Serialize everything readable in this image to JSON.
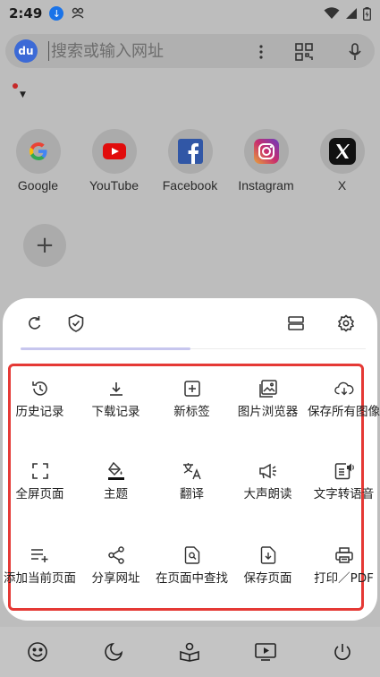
{
  "status_bar": {
    "time": "2:49",
    "icons": [
      "download-icon",
      "pilot-icon",
      "wifi-icon",
      "cellular-icon",
      "battery-icon"
    ]
  },
  "search": {
    "placeholder": "搜索或输入网址",
    "logo_text": "du",
    "icons": [
      "more-vert-icon",
      "qr-scan-icon",
      "mic-icon"
    ]
  },
  "shortcuts": [
    {
      "label": "Google",
      "icon": "google-icon"
    },
    {
      "label": "YouTube",
      "icon": "youtube-icon"
    },
    {
      "label": "Facebook",
      "icon": "facebook-icon"
    },
    {
      "label": "Instagram",
      "icon": "instagram-icon"
    },
    {
      "label": "X",
      "icon": "x-icon"
    }
  ],
  "add_shortcut": "+",
  "menu": {
    "top_icons": [
      "refresh-icon",
      "shield-icon",
      "layout-icon",
      "settings-icon"
    ],
    "items": [
      {
        "label": "历史记录",
        "icon": "history-icon"
      },
      {
        "label": "下载记录",
        "icon": "download-icon"
      },
      {
        "label": "新标签",
        "icon": "new-tab-icon"
      },
      {
        "label": "图片浏览器",
        "icon": "image-viewer-icon"
      },
      {
        "label": "保存所有图像",
        "icon": "cloud-download-icon"
      },
      {
        "label": "全屏页面",
        "icon": "fullscreen-icon"
      },
      {
        "label": "主题",
        "icon": "paint-bucket-icon"
      },
      {
        "label": "翻译",
        "icon": "translate-icon"
      },
      {
        "label": "大声朗读",
        "icon": "megaphone-icon"
      },
      {
        "label": "文字转语音",
        "icon": "text-to-speech-icon"
      },
      {
        "label": "添加当前页面",
        "icon": "playlist-add-icon"
      },
      {
        "label": "分享网址",
        "icon": "share-icon"
      },
      {
        "label": "在页面中查找",
        "icon": "find-in-page-icon"
      },
      {
        "label": "保存页面",
        "icon": "save-page-icon"
      },
      {
        "label": "打印／PDF",
        "icon": "print-icon"
      }
    ]
  },
  "bottom_nav": [
    "smile-icon",
    "moon-icon",
    "reader-icon",
    "tv-play-icon",
    "power-icon"
  ],
  "colors": {
    "highlight_border": "#e53935",
    "tab_indicator": "#c7c6ee",
    "dim_background": "#bdbdbd"
  }
}
